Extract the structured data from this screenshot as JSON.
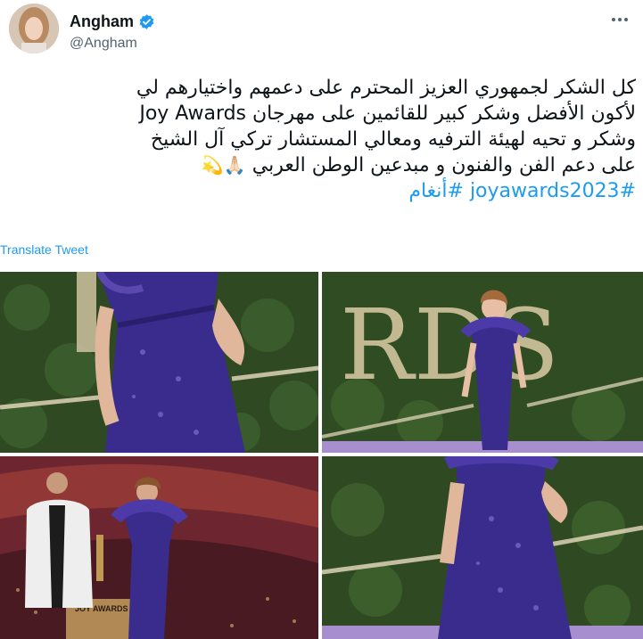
{
  "user": {
    "name": "Angham",
    "handle": "@Angham"
  },
  "tweet": {
    "lines": [
      "كل الشكر لجمهوري العزيز المحترم على دعمهم واختيارهم لي",
      "لأكون الأفضل وشكر كبير للقائمين على مهرجان Joy Awards",
      "وشكر و تحيه لهيئة الترفيه ومعالي المستشار تركي آل الشيخ",
      "على دعم الفن والفنون و مبدعين الوطن العربي"
    ],
    "emojis": "🙏🏻💫",
    "hashtags": "#joyawards2023 #أنغام"
  },
  "translate_label": "Translate Tweet",
  "photo_signs": {
    "top_right": "RDS",
    "bottom_left": "JOY AWARDS"
  },
  "colors": {
    "accent": "#1d9bf0",
    "dress": "#3a2c8c",
    "foliage": "#2f4a22"
  }
}
